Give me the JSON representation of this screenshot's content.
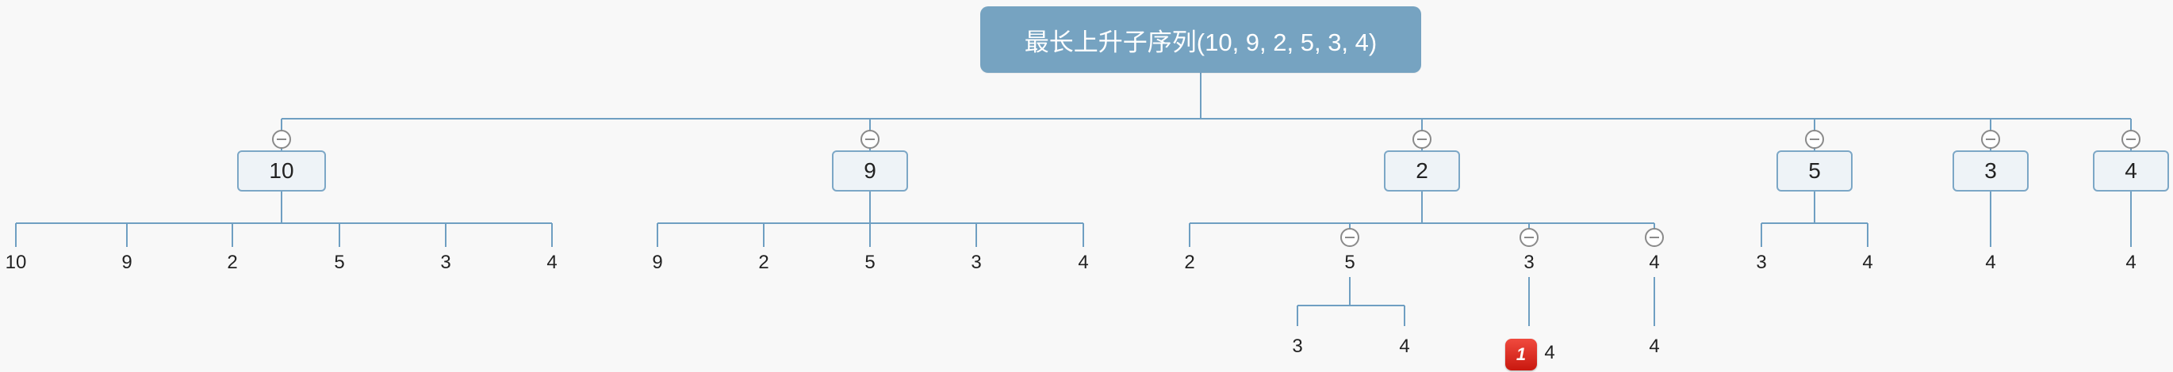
{
  "root": {
    "title": "最长上升子序列(10, 9, 2, 5, 3, 4)"
  },
  "branches": [
    {
      "label": "10",
      "children": [
        "10",
        "9",
        "2",
        "5",
        "3",
        "4"
      ]
    },
    {
      "label": "9",
      "children": [
        "9",
        "2",
        "5",
        "3",
        "4"
      ]
    },
    {
      "label": "2",
      "children": [
        "2",
        "5",
        "3",
        "4"
      ]
    },
    {
      "label": "5",
      "children": [
        "3",
        "4"
      ]
    },
    {
      "label": "3",
      "children": [
        "4"
      ]
    },
    {
      "label": "4",
      "children": [
        "4"
      ]
    }
  ],
  "subtrees": {
    "b2_c1": [
      "3",
      "4"
    ],
    "b2_c2": [
      "4"
    ],
    "b2_c3": [
      "4"
    ]
  },
  "badge": {
    "text": "1"
  }
}
